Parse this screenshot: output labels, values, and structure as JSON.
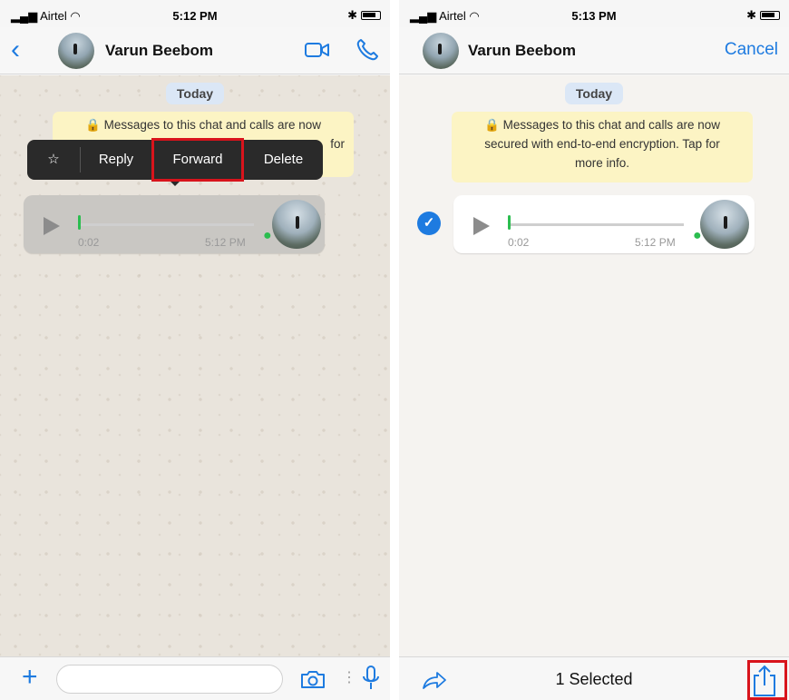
{
  "left": {
    "status": {
      "carrier": "Airtel",
      "time": "5:12 PM"
    },
    "header": {
      "contact_name": "Varun Beebom",
      "back_icon": "chevron-left-icon",
      "video_icon": "video-camera-icon",
      "call_icon": "phone-icon"
    },
    "date_label": "Today",
    "encryption_notice": {
      "line1": "🔒 Messages to this chat and calls are now",
      "line2": "for"
    },
    "context_menu": {
      "star": "☆",
      "reply": "Reply",
      "forward": "Forward",
      "delete": "Delete"
    },
    "voice_message": {
      "duration": "0:02",
      "time": "5:12 PM"
    },
    "composer": {
      "plus_icon": "plus-icon",
      "camera_icon": "camera-icon",
      "mic_icon": "microphone-icon"
    }
  },
  "right": {
    "status": {
      "carrier": "Airtel",
      "time": "5:13 PM"
    },
    "header": {
      "contact_name": "Varun Beebom",
      "cancel": "Cancel"
    },
    "date_label": "Today",
    "encryption_notice": {
      "line1": "🔒 Messages to this chat and calls are now",
      "line2": "secured with end-to-end encryption. Tap for",
      "line3": "more info."
    },
    "voice_message": {
      "duration": "0:02",
      "time": "5:12 PM"
    },
    "selection_bar": {
      "count_label": "1 Selected",
      "forward_icon": "forward-arrow-icon",
      "share_icon": "share-icon"
    }
  },
  "colors": {
    "accent": "#1e7be0",
    "highlight": "#d8141c",
    "notice": "#fcf4c4",
    "mic_green": "#2bbd4f"
  }
}
